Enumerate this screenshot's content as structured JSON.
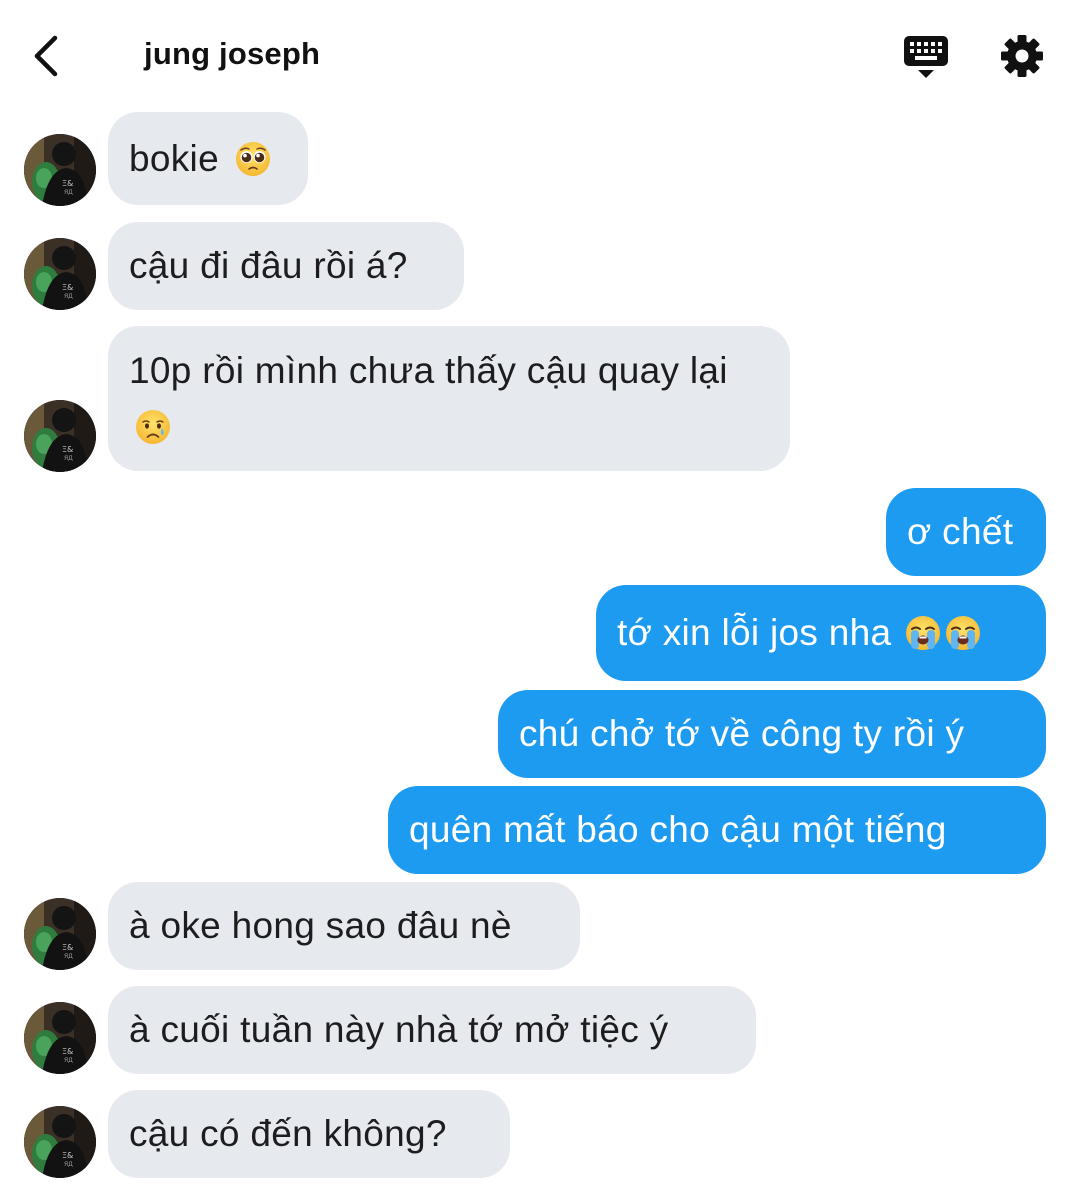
{
  "header": {
    "title": "jung joseph"
  },
  "messages": [
    {
      "dir": "in",
      "text": "bokie",
      "emoji": [
        "pleading-face-emoji"
      ]
    },
    {
      "dir": "in",
      "text": "cậu đi đâu rồi á?"
    },
    {
      "dir": "in",
      "text": "10p rồi mình chưa thấy cậu quay lại",
      "emoji": [
        "crying-face-emoji"
      ]
    },
    {
      "dir": "out",
      "text": "ơ chết"
    },
    {
      "dir": "out",
      "text": "tớ xin lỗi jos nha",
      "emoji": [
        "loudly-crying-face-emoji",
        "loudly-crying-face-emoji"
      ]
    },
    {
      "dir": "out",
      "text": "chú chở tớ về công ty rồi ý"
    },
    {
      "dir": "out",
      "text": "quên mất báo cho cậu một tiếng"
    },
    {
      "dir": "in",
      "text": "à oke hong sao đâu nè"
    },
    {
      "dir": "in",
      "text": "à cuối tuần này nhà tớ mở tiệc ý"
    },
    {
      "dir": "in",
      "text": "cậu có đến không?"
    }
  ],
  "colors": {
    "incoming_bubble": "#e6e9ee",
    "outgoing_bubble": "#1d9bf0"
  }
}
